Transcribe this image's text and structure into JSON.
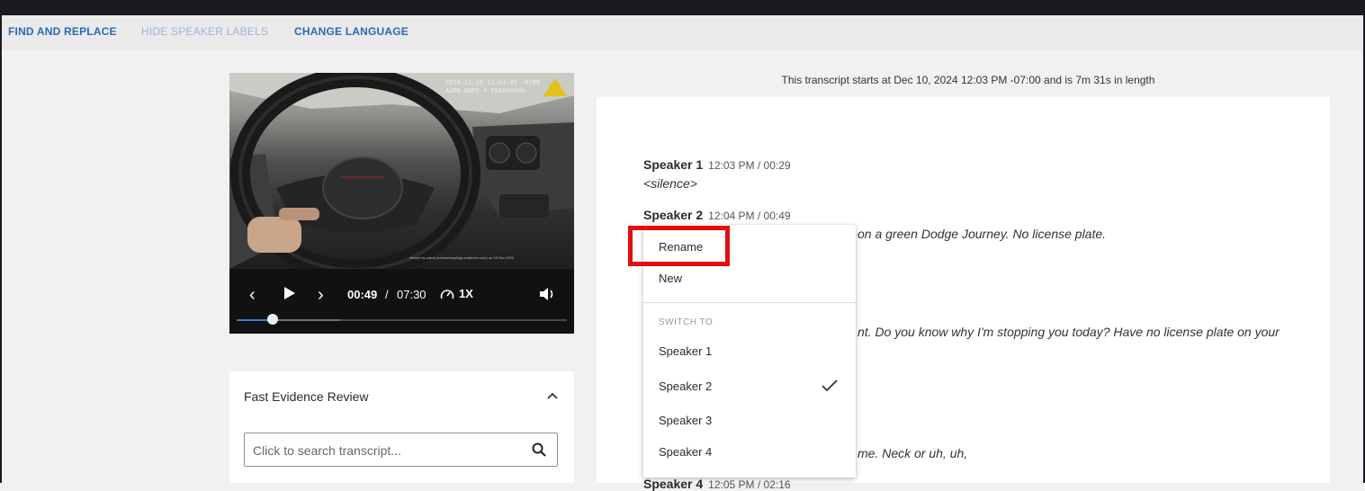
{
  "toolbar": {
    "find_replace": "FIND AND REPLACE",
    "hide_speaker_labels": "HIDE SPEAKER LABELS",
    "change_language": "CHANGE LANGUAGE"
  },
  "video": {
    "current_time": "00:49",
    "separator": "/",
    "duration": "07:30",
    "speed": "1X",
    "progress_fraction": 0.109
  },
  "fast_evidence_review": {
    "title": "Fast Evidence Review",
    "search_placeholder": "Click to search transcript..."
  },
  "transcript_info": "This transcript starts at Dec 10, 2024 12:03 PM -07:00 and is 7m 31s in length",
  "transcript": [
    {
      "speaker": "Speaker 1",
      "time": "12:03 PM / 00:29",
      "text": "<silence>"
    },
    {
      "speaker": "Speaker 2",
      "time": "12:04 PM / 00:49"
    },
    {
      "text": "on a green Dodge Journey. No license plate."
    },
    {
      "text": "nt. Do you know why I'm stopping you today? Have no license plate on your"
    },
    {
      "text": "me. Neck or uh, uh,"
    },
    {
      "speaker": "Speaker 4",
      "time": "12:05 PM / 02:16"
    }
  ],
  "speaker_menu": {
    "rename": "Rename",
    "new": "New",
    "switch_to": "SWITCH TO",
    "options": [
      "Speaker 1",
      "Speaker 2",
      "Speaker 3",
      "Speaker 4"
    ],
    "selected": "Speaker 2"
  },
  "colors": {
    "accent": "#2a68b8",
    "highlight": "#e01010",
    "seek_fill": "#3d7be0"
  }
}
